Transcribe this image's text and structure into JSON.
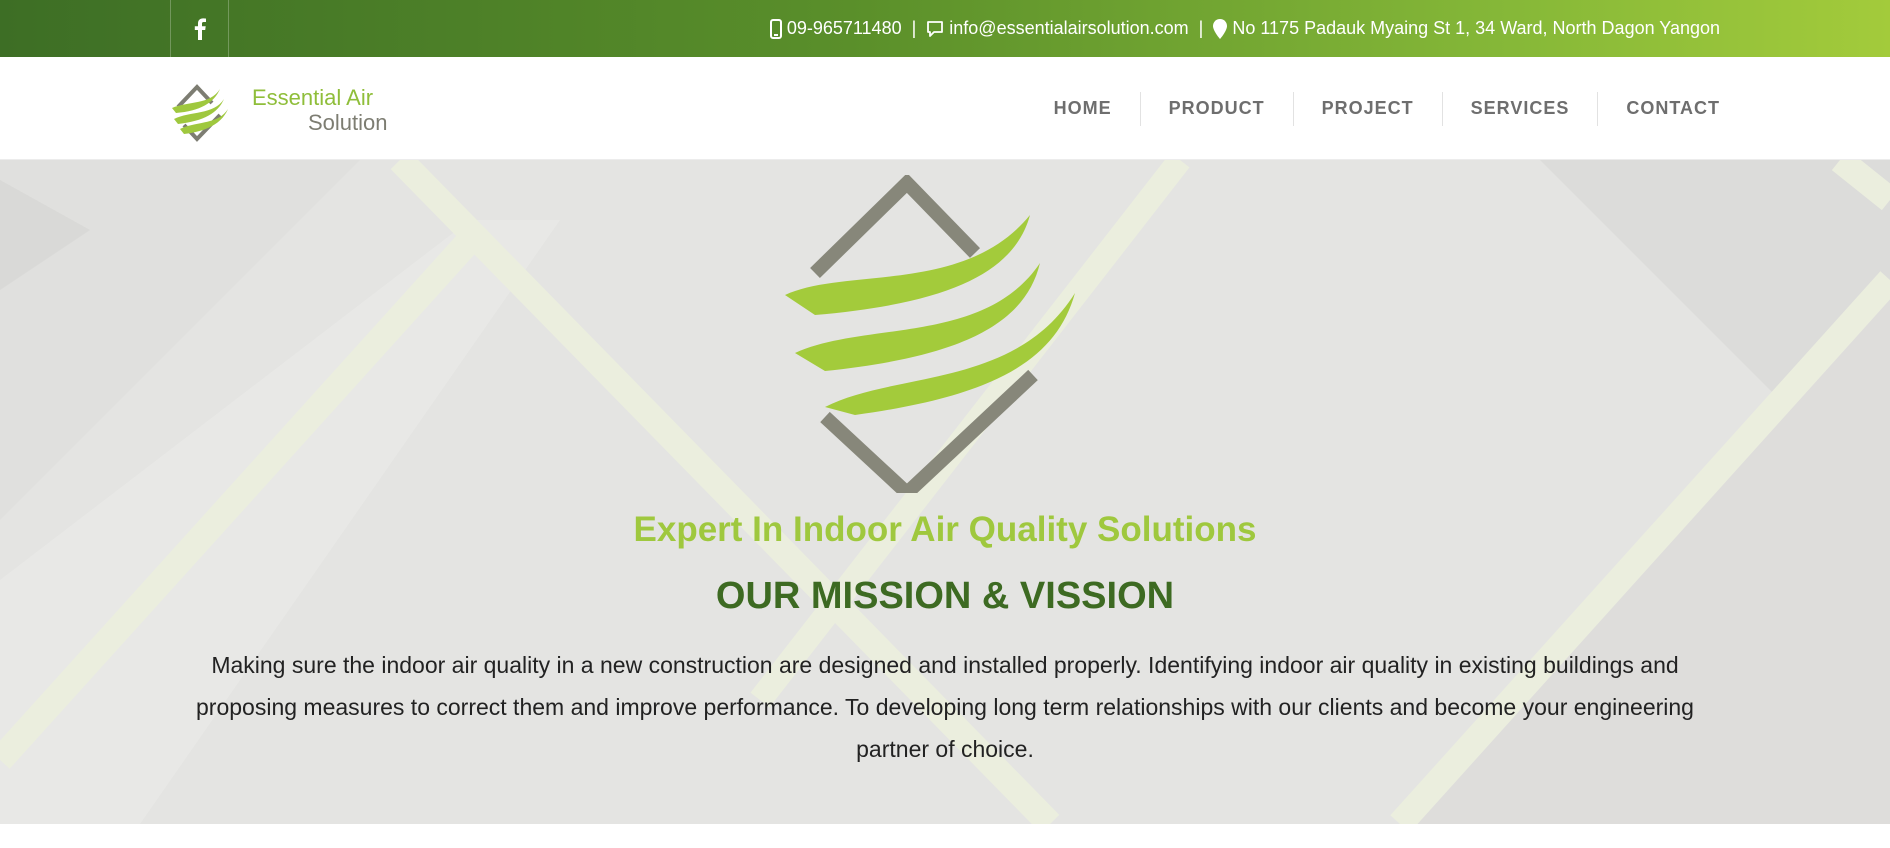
{
  "topbar": {
    "facebook_icon": "facebook-icon",
    "phone": "09-965711480",
    "email": "info@essentialairsolution.com",
    "address": "No 1175 Padauk Myaing St 1, 34 Ward, North Dagon Yangon",
    "separator": "|"
  },
  "header": {
    "logo_line1": "Essential Air",
    "logo_line2": "Solution",
    "nav": [
      "HOME",
      "PRODUCT",
      "PROJECT",
      "SERVICES",
      "CONTACT"
    ]
  },
  "hero": {
    "tagline": "Expert In Indoor Air Quality Solutions",
    "title": "OUR MISSION & VISSION",
    "text": "Making sure the indoor air quality in a new construction are designed and installed properly. Identifying indoor air quality in existing buildings and proposing measures to correct them and improve performance. To developing long term relationships with our clients and become your engineering partner of choice."
  },
  "colors": {
    "brand_green": "#9fc83e",
    "dark_green": "#3d6a22",
    "logo_gray": "#7d7d72"
  }
}
